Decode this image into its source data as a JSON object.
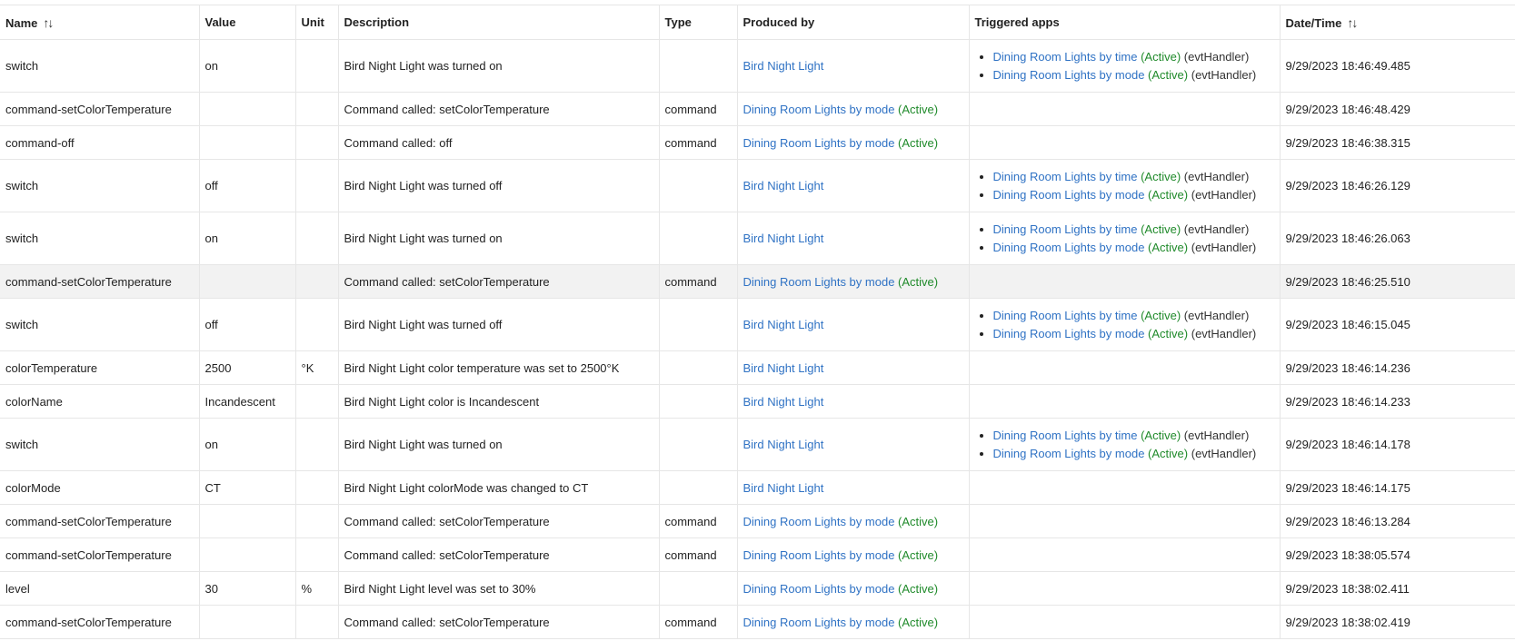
{
  "table": {
    "columns": [
      {
        "key": "name",
        "label": "Name",
        "sortable": true
      },
      {
        "key": "value",
        "label": "Value",
        "sortable": false
      },
      {
        "key": "unit",
        "label": "Unit",
        "sortable": false
      },
      {
        "key": "description",
        "label": "Description",
        "sortable": false
      },
      {
        "key": "type",
        "label": "Type",
        "sortable": false
      },
      {
        "key": "produced_by",
        "label": "Produced by",
        "sortable": false
      },
      {
        "key": "triggered_apps",
        "label": "Triggered apps",
        "sortable": false
      },
      {
        "key": "datetime",
        "label": "Date/Time",
        "sortable": true
      }
    ],
    "sort_icon_glyph": "↑↓",
    "rows": [
      {
        "name": "switch",
        "value": "on",
        "unit": "",
        "description": "Bird Night Light was turned on",
        "type": "",
        "produced_by": {
          "label": "Bird Night Light",
          "status": ""
        },
        "triggered_apps": [
          {
            "label": "Dining Room Lights by time",
            "status": "(Active)",
            "handler": "(evtHandler)"
          },
          {
            "label": "Dining Room Lights by mode",
            "status": "(Active)",
            "handler": "(evtHandler)"
          }
        ],
        "datetime": "9/29/2023 18:46:49.485",
        "highlighted": false
      },
      {
        "name": "command-setColorTemperature",
        "value": "",
        "unit": "",
        "description": "Command called: setColorTemperature",
        "type": "command",
        "produced_by": {
          "label": "Dining Room Lights by mode",
          "status": "(Active)"
        },
        "triggered_apps": [],
        "datetime": "9/29/2023 18:46:48.429",
        "highlighted": false
      },
      {
        "name": "command-off",
        "value": "",
        "unit": "",
        "description": "Command called: off",
        "type": "command",
        "produced_by": {
          "label": "Dining Room Lights by mode",
          "status": "(Active)"
        },
        "triggered_apps": [],
        "datetime": "9/29/2023 18:46:38.315",
        "highlighted": false
      },
      {
        "name": "switch",
        "value": "off",
        "unit": "",
        "description": "Bird Night Light was turned off",
        "type": "",
        "produced_by": {
          "label": "Bird Night Light",
          "status": ""
        },
        "triggered_apps": [
          {
            "label": "Dining Room Lights by time",
            "status": "(Active)",
            "handler": "(evtHandler)"
          },
          {
            "label": "Dining Room Lights by mode",
            "status": "(Active)",
            "handler": "(evtHandler)"
          }
        ],
        "datetime": "9/29/2023 18:46:26.129",
        "highlighted": false
      },
      {
        "name": "switch",
        "value": "on",
        "unit": "",
        "description": "Bird Night Light was turned on",
        "type": "",
        "produced_by": {
          "label": "Bird Night Light",
          "status": ""
        },
        "triggered_apps": [
          {
            "label": "Dining Room Lights by time",
            "status": "(Active)",
            "handler": "(evtHandler)"
          },
          {
            "label": "Dining Room Lights by mode",
            "status": "(Active)",
            "handler": "(evtHandler)"
          }
        ],
        "datetime": "9/29/2023 18:46:26.063",
        "highlighted": false
      },
      {
        "name": "command-setColorTemperature",
        "value": "",
        "unit": "",
        "description": "Command called: setColorTemperature",
        "type": "command",
        "produced_by": {
          "label": "Dining Room Lights by mode",
          "status": "(Active)"
        },
        "triggered_apps": [],
        "datetime": "9/29/2023 18:46:25.510",
        "highlighted": true
      },
      {
        "name": "switch",
        "value": "off",
        "unit": "",
        "description": "Bird Night Light was turned off",
        "type": "",
        "produced_by": {
          "label": "Bird Night Light",
          "status": ""
        },
        "triggered_apps": [
          {
            "label": "Dining Room Lights by time",
            "status": "(Active)",
            "handler": "(evtHandler)"
          },
          {
            "label": "Dining Room Lights by mode",
            "status": "(Active)",
            "handler": "(evtHandler)"
          }
        ],
        "datetime": "9/29/2023 18:46:15.045",
        "highlighted": false
      },
      {
        "name": "colorTemperature",
        "value": "2500",
        "unit": "°K",
        "description": "Bird Night Light color temperature was set to 2500°K",
        "type": "",
        "produced_by": {
          "label": "Bird Night Light",
          "status": ""
        },
        "triggered_apps": [],
        "datetime": "9/29/2023 18:46:14.236",
        "highlighted": false
      },
      {
        "name": "colorName",
        "value": "Incandescent",
        "unit": "",
        "description": "Bird Night Light color is Incandescent",
        "type": "",
        "produced_by": {
          "label": "Bird Night Light",
          "status": ""
        },
        "triggered_apps": [],
        "datetime": "9/29/2023 18:46:14.233",
        "highlighted": false
      },
      {
        "name": "switch",
        "value": "on",
        "unit": "",
        "description": "Bird Night Light was turned on",
        "type": "",
        "produced_by": {
          "label": "Bird Night Light",
          "status": ""
        },
        "triggered_apps": [
          {
            "label": "Dining Room Lights by time",
            "status": "(Active)",
            "handler": "(evtHandler)"
          },
          {
            "label": "Dining Room Lights by mode",
            "status": "(Active)",
            "handler": "(evtHandler)"
          }
        ],
        "datetime": "9/29/2023 18:46:14.178",
        "highlighted": false
      },
      {
        "name": "colorMode",
        "value": "CT",
        "unit": "",
        "description": "Bird Night Light colorMode was changed to CT",
        "type": "",
        "produced_by": {
          "label": "Bird Night Light",
          "status": ""
        },
        "triggered_apps": [],
        "datetime": "9/29/2023 18:46:14.175",
        "highlighted": false
      },
      {
        "name": "command-setColorTemperature",
        "value": "",
        "unit": "",
        "description": "Command called: setColorTemperature",
        "type": "command",
        "produced_by": {
          "label": "Dining Room Lights by mode",
          "status": "(Active)"
        },
        "triggered_apps": [],
        "datetime": "9/29/2023 18:46:13.284",
        "highlighted": false
      },
      {
        "name": "command-setColorTemperature",
        "value": "",
        "unit": "",
        "description": "Command called: setColorTemperature",
        "type": "command",
        "produced_by": {
          "label": "Dining Room Lights by mode",
          "status": "(Active)"
        },
        "triggered_apps": [],
        "datetime": "9/29/2023 18:38:05.574",
        "highlighted": false
      },
      {
        "name": "level",
        "value": "30",
        "unit": "%",
        "description": "Bird Night Light level was set to 30%",
        "type": "",
        "produced_by": {
          "label": "Dining Room Lights by mode",
          "status": "(Active)"
        },
        "triggered_apps": [],
        "datetime": "9/29/2023 18:38:02.411",
        "highlighted": false
      },
      {
        "name": "command-setColorTemperature",
        "value": "",
        "unit": "",
        "description": "Command called: setColorTemperature",
        "type": "command",
        "produced_by": {
          "label": "Dining Room Lights by mode",
          "status": "(Active)"
        },
        "triggered_apps": [],
        "datetime": "9/29/2023 18:38:02.419",
        "highlighted": false
      }
    ]
  },
  "colors": {
    "link": "#2f72c4",
    "active": "#1f8a2a",
    "row_highlight": "#f2f2f2",
    "grid": "#e6e6e6"
  }
}
